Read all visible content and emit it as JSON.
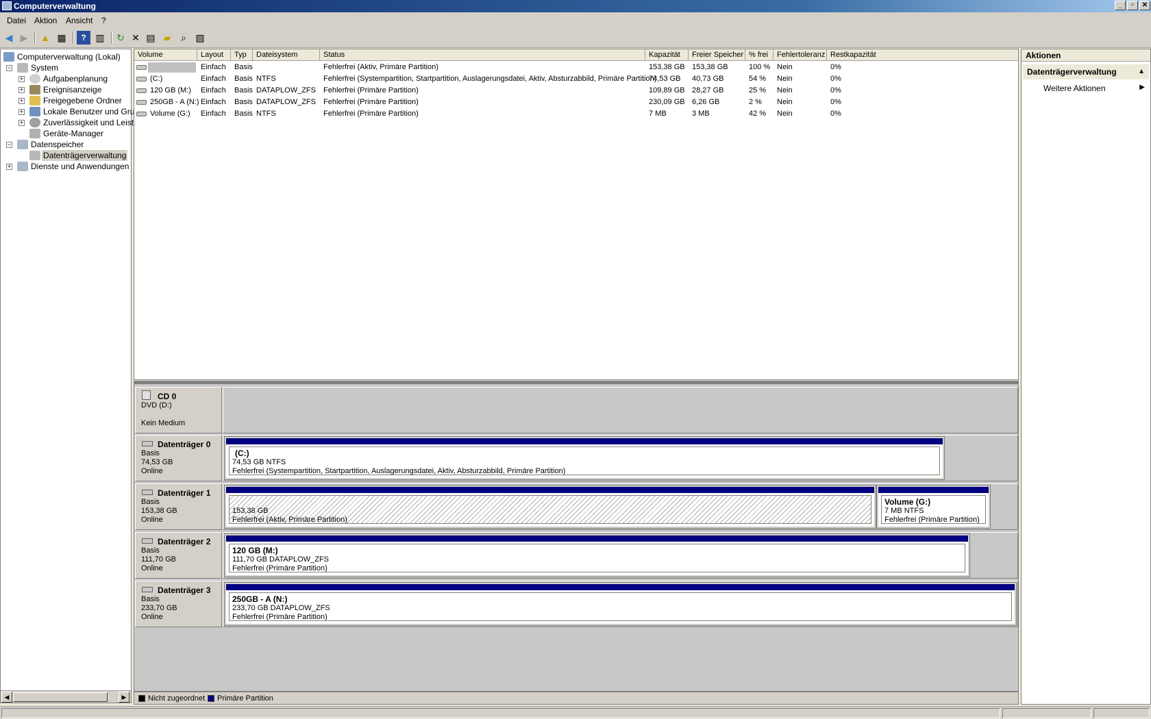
{
  "window": {
    "title": "Computerverwaltung",
    "min_label": "_",
    "max_label": "▫",
    "close_label": "✕"
  },
  "menu": [
    "Datei",
    "Aktion",
    "Ansicht",
    "?"
  ],
  "tree": {
    "root": "Computerverwaltung (Lokal)",
    "system": "System",
    "aufgaben": "Aufgabenplanung",
    "ereignis": "Ereignisanzeige",
    "freigaben": "Freigegebene Ordner",
    "benutzer": "Lokale Benutzer und Grup",
    "zuverl": "Zuverlässigkeit und Leistu",
    "geraete": "Geräte-Manager",
    "datenspeicher": "Datenspeicher",
    "dtv": "Datenträgerverwaltung",
    "dienste": "Dienste und Anwendungen",
    "expand_plus": "+",
    "expand_minus": "−"
  },
  "volume_table": {
    "columns": [
      "Volume",
      "Layout",
      "Typ",
      "Dateisystem",
      "Status",
      "Kapazität",
      "Freier Speicher",
      "% frei",
      "Fehlertoleranz",
      "Restkapazität"
    ],
    "rows": [
      [
        "",
        "Einfach",
        "Basis",
        "",
        "Fehlerfrei (Aktiv, Primäre Partition)",
        "153,38 GB",
        "153,38 GB",
        "100 %",
        "Nein",
        "0%"
      ],
      [
        "(C:)",
        "Einfach",
        "Basis",
        "NTFS",
        "Fehlerfrei (Systempartition, Startpartition, Auslagerungsdatei, Aktiv, Absturzabbild, Primäre Partition)",
        "74,53 GB",
        "40,73 GB",
        "54 %",
        "Nein",
        "0%"
      ],
      [
        "120 GB (M:)",
        "Einfach",
        "Basis",
        "DATAPLOW_ZFS",
        "Fehlerfrei (Primäre Partition)",
        "109,89 GB",
        "28,27 GB",
        "25 %",
        "Nein",
        "0%"
      ],
      [
        "250GB - A (N:)",
        "Einfach",
        "Basis",
        "DATAPLOW_ZFS",
        "Fehlerfrei (Primäre Partition)",
        "230,09 GB",
        "6,26 GB",
        "2 %",
        "Nein",
        "0%"
      ],
      [
        "Volume (G:)",
        "Einfach",
        "Basis",
        "NTFS",
        "Fehlerfrei (Primäre Partition)",
        "7 MB",
        "3 MB",
        "42 %",
        "Nein",
        "0%"
      ]
    ]
  },
  "disks": [
    {
      "name": "CD 0",
      "lines": [
        "DVD (D:)",
        "",
        "Kein Medium"
      ]
    },
    {
      "name": "Datenträger 0",
      "lines": [
        "Basis",
        "74,53 GB",
        "Online"
      ]
    },
    {
      "name": "Datenträger 1",
      "lines": [
        "Basis",
        "153,38 GB",
        "Online"
      ]
    },
    {
      "name": "Datenträger 2",
      "lines": [
        "Basis",
        "111,70 GB",
        "Online"
      ]
    },
    {
      "name": "Datenträger 3",
      "lines": [
        "Basis",
        "233,70 GB",
        "Online"
      ]
    }
  ],
  "partitions": {
    "c": {
      "title": "(C:)",
      "size": "74,53 GB NTFS",
      "status": "Fehlerfrei (Systempartition, Startpartition, Auslagerungsdatei, Aktiv, Absturzabbild, Primäre Partition)"
    },
    "d1": {
      "title": "",
      "size": "153,38 GB",
      "status": "Fehlerfrei (Aktiv, Primäre Partition)"
    },
    "g": {
      "title": "Volume  (G:)",
      "size": "7 MB NTFS",
      "status": "Fehlerfrei (Primäre Partition)"
    },
    "m": {
      "title": "120 GB  (M:)",
      "size": "111,70 GB DATAPLOW_ZFS",
      "status": "Fehlerfrei (Primäre Partition)"
    },
    "n": {
      "title": "250GB - A  (N:)",
      "size": "233,70 GB DATAPLOW_ZFS",
      "status": "Fehlerfrei (Primäre Partition)"
    }
  },
  "legend": {
    "unallocated": "Nicht zugeordnet",
    "primary": "Primäre Partition"
  },
  "actions": {
    "header": "Aktionen",
    "section": "Datenträgerverwaltung",
    "more": "Weitere Aktionen"
  },
  "colors": {
    "primary_partition": "#000080",
    "unallocated": "#000000"
  }
}
